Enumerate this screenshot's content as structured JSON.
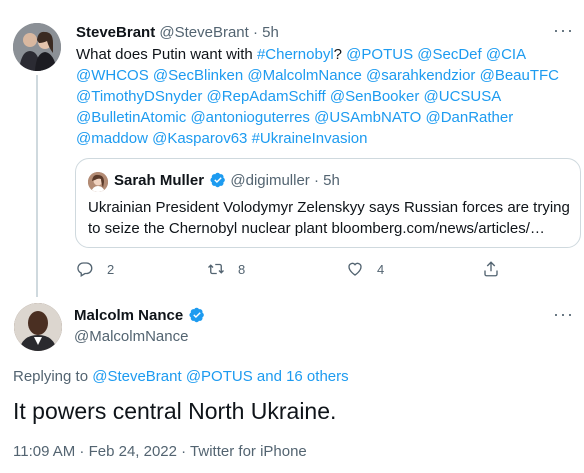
{
  "parent_tweet": {
    "display_name": "SteveBrant",
    "handle": "@SteveBrant",
    "separator": "·",
    "time": "5h",
    "text_plain": "What does Putin want with ",
    "mentions": [
      "#Chernobyl",
      "@POTUS",
      "@SecDef",
      "@CIA",
      "@WHCOS",
      "@SecBlinken",
      "@MalcolmNance",
      "@sarahkendzior",
      "@BeauTFC",
      "@TimothyDSnyder",
      "@RepAdamSchiff",
      "@SenBooker",
      "@UCSUSA",
      "@BulletinAtomic",
      "@antonioguterres",
      "@USAmbNATO",
      "@DanRather",
      "@maddow",
      "@Kasparov63",
      "#UkraineInvasion"
    ],
    "text_q": "?",
    "quoted": {
      "display_name": "Sarah Muller",
      "handle": "@digimuller",
      "separator": "·",
      "time": "5h",
      "text": "Ukrainian President Volodymyr Zelenskyy says Russian forces are trying to seize the Chernobyl nuclear plant bloomberg.com/news/articles/…"
    },
    "actions": {
      "reply_count": "2",
      "retweet_count": "8",
      "like_count": "4"
    },
    "icons": [
      "reply-icon",
      "retweet-icon",
      "like-icon",
      "share-icon",
      "more-icon",
      "verified-icon"
    ]
  },
  "reply_tweet": {
    "display_name": "Malcolm Nance",
    "handle": "@MalcolmNance",
    "replying_prefix": "Replying to",
    "replying_to": "@SteveBrant @POTUS and 16 others",
    "text": "It powers central North Ukraine.",
    "meta": "11:09 AM · Feb 24, 2022 · Twitter for iPhone"
  },
  "colors": {
    "link": "#1d9bf0",
    "muted": "#536471",
    "text": "#0f1419",
    "border": "#cfd9de"
  }
}
